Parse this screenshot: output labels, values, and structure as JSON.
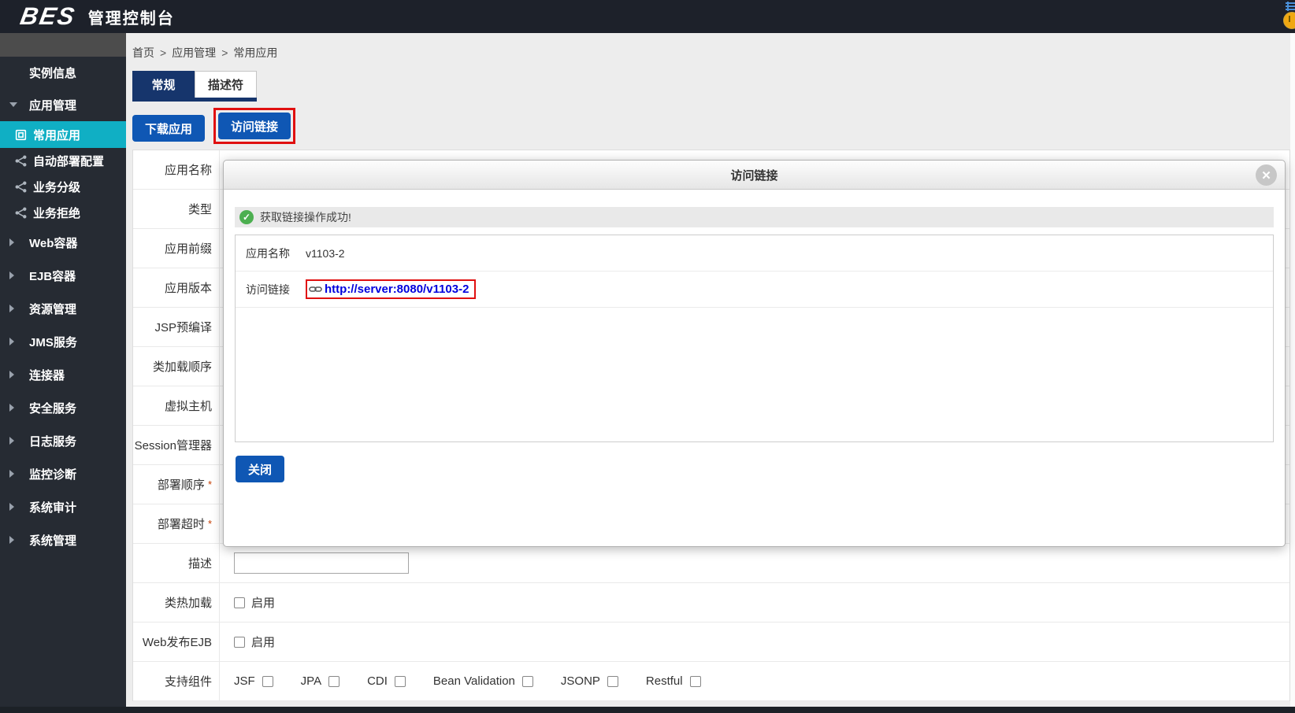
{
  "colors": {
    "header_bg": "#1d212a",
    "sidebar_bg": "#262b33",
    "sidebar_active_bg": "#10afc4",
    "tab_active_bg": "#16356c",
    "primary_button_bg": "#0f57b4",
    "link_blue": "#0000dd",
    "annotation_red": "#e01010",
    "success_green": "#4caf50",
    "content_bg": "#ededed"
  },
  "header": {
    "logo": "BES",
    "title": "管理控制台"
  },
  "sidebar": {
    "items": [
      {
        "key": "instance-info",
        "label": "实例信息",
        "type": "item"
      },
      {
        "key": "app-management",
        "label": "应用管理",
        "type": "group",
        "expanded": true
      },
      {
        "key": "common-apps",
        "label": "常用应用",
        "type": "subitem",
        "icon": "app-window",
        "active": true
      },
      {
        "key": "auto-deploy-config",
        "label": "自动部署配置",
        "type": "subitem",
        "icon": "share"
      },
      {
        "key": "business-grading",
        "label": "业务分级",
        "type": "subitem",
        "icon": "share"
      },
      {
        "key": "business-reject",
        "label": "业务拒绝",
        "type": "subitem",
        "icon": "share"
      },
      {
        "key": "web-container",
        "label": "Web容器",
        "type": "group"
      },
      {
        "key": "ejb-container",
        "label": "EJB容器",
        "type": "group"
      },
      {
        "key": "resource-management",
        "label": "资源管理",
        "type": "group"
      },
      {
        "key": "jms-service",
        "label": "JMS服务",
        "type": "group"
      },
      {
        "key": "connector",
        "label": "连接器",
        "type": "group"
      },
      {
        "key": "security-service",
        "label": "安全服务",
        "type": "group"
      },
      {
        "key": "log-service",
        "label": "日志服务",
        "type": "group"
      },
      {
        "key": "monitor-diagnosis",
        "label": "监控诊断",
        "type": "group"
      },
      {
        "key": "system-audit",
        "label": "系统审计",
        "type": "group"
      },
      {
        "key": "system-management",
        "label": "系统管理",
        "type": "group"
      }
    ]
  },
  "breadcrumb": {
    "items": [
      "首页",
      "应用管理",
      "常用应用"
    ],
    "separator": ">"
  },
  "tabs": [
    {
      "key": "general",
      "label": "常规",
      "active": true
    },
    {
      "key": "descriptor",
      "label": "描述符",
      "active": false
    }
  ],
  "toolbar": {
    "buttons": [
      {
        "key": "download-app",
        "label": "下载应用",
        "annotated": false
      },
      {
        "key": "access-link",
        "label": "访问链接",
        "annotated": true
      }
    ]
  },
  "form": {
    "rows": [
      {
        "key": "app-name",
        "label": "应用名称"
      },
      {
        "key": "type",
        "label": "类型"
      },
      {
        "key": "app-prefix",
        "label": "应用前缀"
      },
      {
        "key": "app-version",
        "label": "应用版本"
      },
      {
        "key": "jsp-precompile",
        "label": "JSP预编译"
      },
      {
        "key": "classload-order",
        "label": "类加载顺序"
      },
      {
        "key": "virtual-host",
        "label": "虚拟主机"
      },
      {
        "key": "session-manager",
        "label": "Session管理器"
      },
      {
        "key": "deploy-order",
        "label": "部署顺序",
        "required": true
      },
      {
        "key": "deploy-timeout",
        "label": "部署超时",
        "required": true
      },
      {
        "key": "description",
        "label": "描述",
        "control": "input",
        "value": "",
        "placeholder": ""
      },
      {
        "key": "class-hot-reload",
        "label": "类热加载",
        "control": "checkbox",
        "checkbox_label": "启用",
        "checked": false
      },
      {
        "key": "web-publish-ejb",
        "label": "Web发布EJB",
        "control": "checkbox",
        "checkbox_label": "启用",
        "checked": false
      },
      {
        "key": "support-components",
        "label": "支持组件",
        "control": "checkbox_group",
        "options": [
          "JSF",
          "JPA",
          "CDI",
          "Bean Validation",
          "JSONP",
          "Restful"
        ]
      }
    ]
  },
  "modal": {
    "title": "访问链接",
    "message": "获取链接操作成功!",
    "fields": [
      {
        "key": "app-name",
        "label": "应用名称",
        "value": "v1103-2",
        "type": "text"
      },
      {
        "key": "access-link",
        "label": "访问链接",
        "value": "http://server:8080/v1103-2",
        "type": "link",
        "annotated": true
      }
    ],
    "close_button": "关闭"
  }
}
